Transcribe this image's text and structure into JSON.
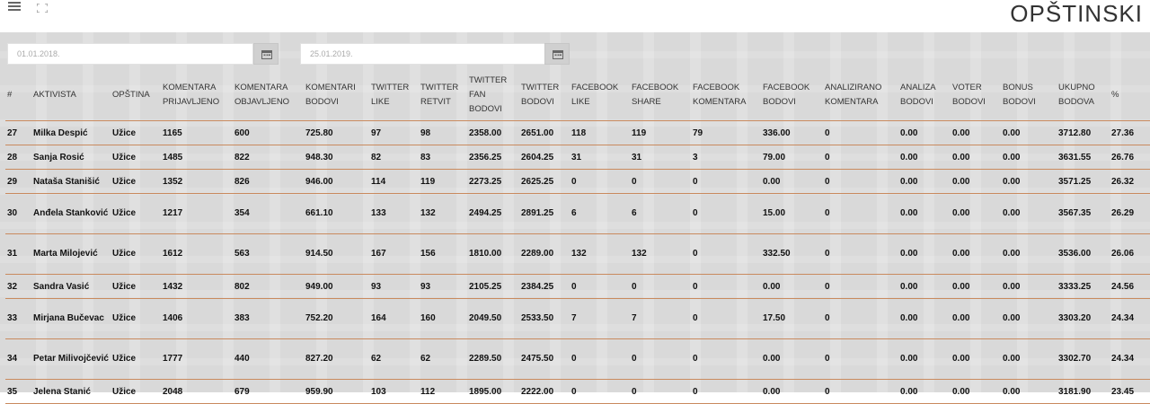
{
  "header": {
    "title": "OPŠTINSKI",
    "menu_icon": "menu-icon",
    "fullscreen_icon": "fullscreen-icon"
  },
  "filters": {
    "date_from": "01.01.2018.",
    "date_to": "25.01.2019.",
    "calendar_icon": "calendar-icon"
  },
  "table": {
    "headers": [
      "#",
      "AKTIVISTA",
      "OPŠTINA",
      "KOMENTARA PRIJAVLJENO",
      "KOMENTARA OBJAVLJENO",
      "KOMENTARI BODOVI",
      "TWITTER LIKE",
      "TWITTER RETVIT",
      "TWITTER FAN BODOVI",
      "TWITTER BODOVI",
      "FACEBOOK LIKE",
      "FACEBOOK SHARE",
      "FACEBOOK KOMENTARA",
      "FACEBOOK BODOVI",
      "ANALIZIRANO KOMENTARA",
      "ANALIZA BODOVI",
      "VOTER BODOVI",
      "BONUS BODOVI",
      "UKUPNO BODOVA",
      "%"
    ],
    "rows": [
      [
        "27",
        "Milka Despić",
        "Užice",
        "1165",
        "600",
        "725.80",
        "97",
        "98",
        "2358.00",
        "2651.00",
        "118",
        "119",
        "79",
        "336.00",
        "0",
        "0.00",
        "0.00",
        "0.00",
        "3712.80",
        "27.36"
      ],
      [
        "28",
        "Sanja Rosić",
        "Užice",
        "1485",
        "822",
        "948.30",
        "82",
        "83",
        "2356.25",
        "2604.25",
        "31",
        "31",
        "3",
        "79.00",
        "0",
        "0.00",
        "0.00",
        "0.00",
        "3631.55",
        "26.76"
      ],
      [
        "29",
        "Nataša Stanišić",
        "Užice",
        "1352",
        "826",
        "946.00",
        "114",
        "119",
        "2273.25",
        "2625.25",
        "0",
        "0",
        "0",
        "0.00",
        "0",
        "0.00",
        "0.00",
        "0.00",
        "3571.25",
        "26.32"
      ],
      [
        "30",
        "Anđela Stanković",
        "Užice",
        "1217",
        "354",
        "661.10",
        "133",
        "132",
        "2494.25",
        "2891.25",
        "6",
        "6",
        "0",
        "15.00",
        "0",
        "0.00",
        "0.00",
        "0.00",
        "3567.35",
        "26.29"
      ],
      [
        "31",
        "Marta Milojević",
        "Užice",
        "1612",
        "563",
        "914.50",
        "167",
        "156",
        "1810.00",
        "2289.00",
        "132",
        "132",
        "0",
        "332.50",
        "0",
        "0.00",
        "0.00",
        "0.00",
        "3536.00",
        "26.06"
      ],
      [
        "32",
        "Sandra Vasić",
        "Užice",
        "1432",
        "802",
        "949.00",
        "93",
        "93",
        "2105.25",
        "2384.25",
        "0",
        "0",
        "0",
        "0.00",
        "0",
        "0.00",
        "0.00",
        "0.00",
        "3333.25",
        "24.56"
      ],
      [
        "33",
        "Mirjana Bučevac",
        "Užice",
        "1406",
        "383",
        "752.20",
        "164",
        "160",
        "2049.50",
        "2533.50",
        "7",
        "7",
        "0",
        "17.50",
        "0",
        "0.00",
        "0.00",
        "0.00",
        "3303.20",
        "24.34"
      ],
      [
        "34",
        "Petar Milivojčević",
        "Užice",
        "1777",
        "440",
        "827.20",
        "62",
        "62",
        "2289.50",
        "2475.50",
        "0",
        "0",
        "0",
        "0.00",
        "0",
        "0.00",
        "0.00",
        "0.00",
        "3302.70",
        "24.34"
      ],
      [
        "35",
        "Jelena Stanić",
        "Užice",
        "2048",
        "679",
        "959.90",
        "103",
        "112",
        "1895.00",
        "2222.00",
        "0",
        "0",
        "0",
        "0.00",
        "0",
        "0.00",
        "0.00",
        "0.00",
        "3181.90",
        "23.45"
      ]
    ]
  },
  "colors": {
    "row_divider": "#c98a5e",
    "background_pattern": "#d9d9d9"
  }
}
